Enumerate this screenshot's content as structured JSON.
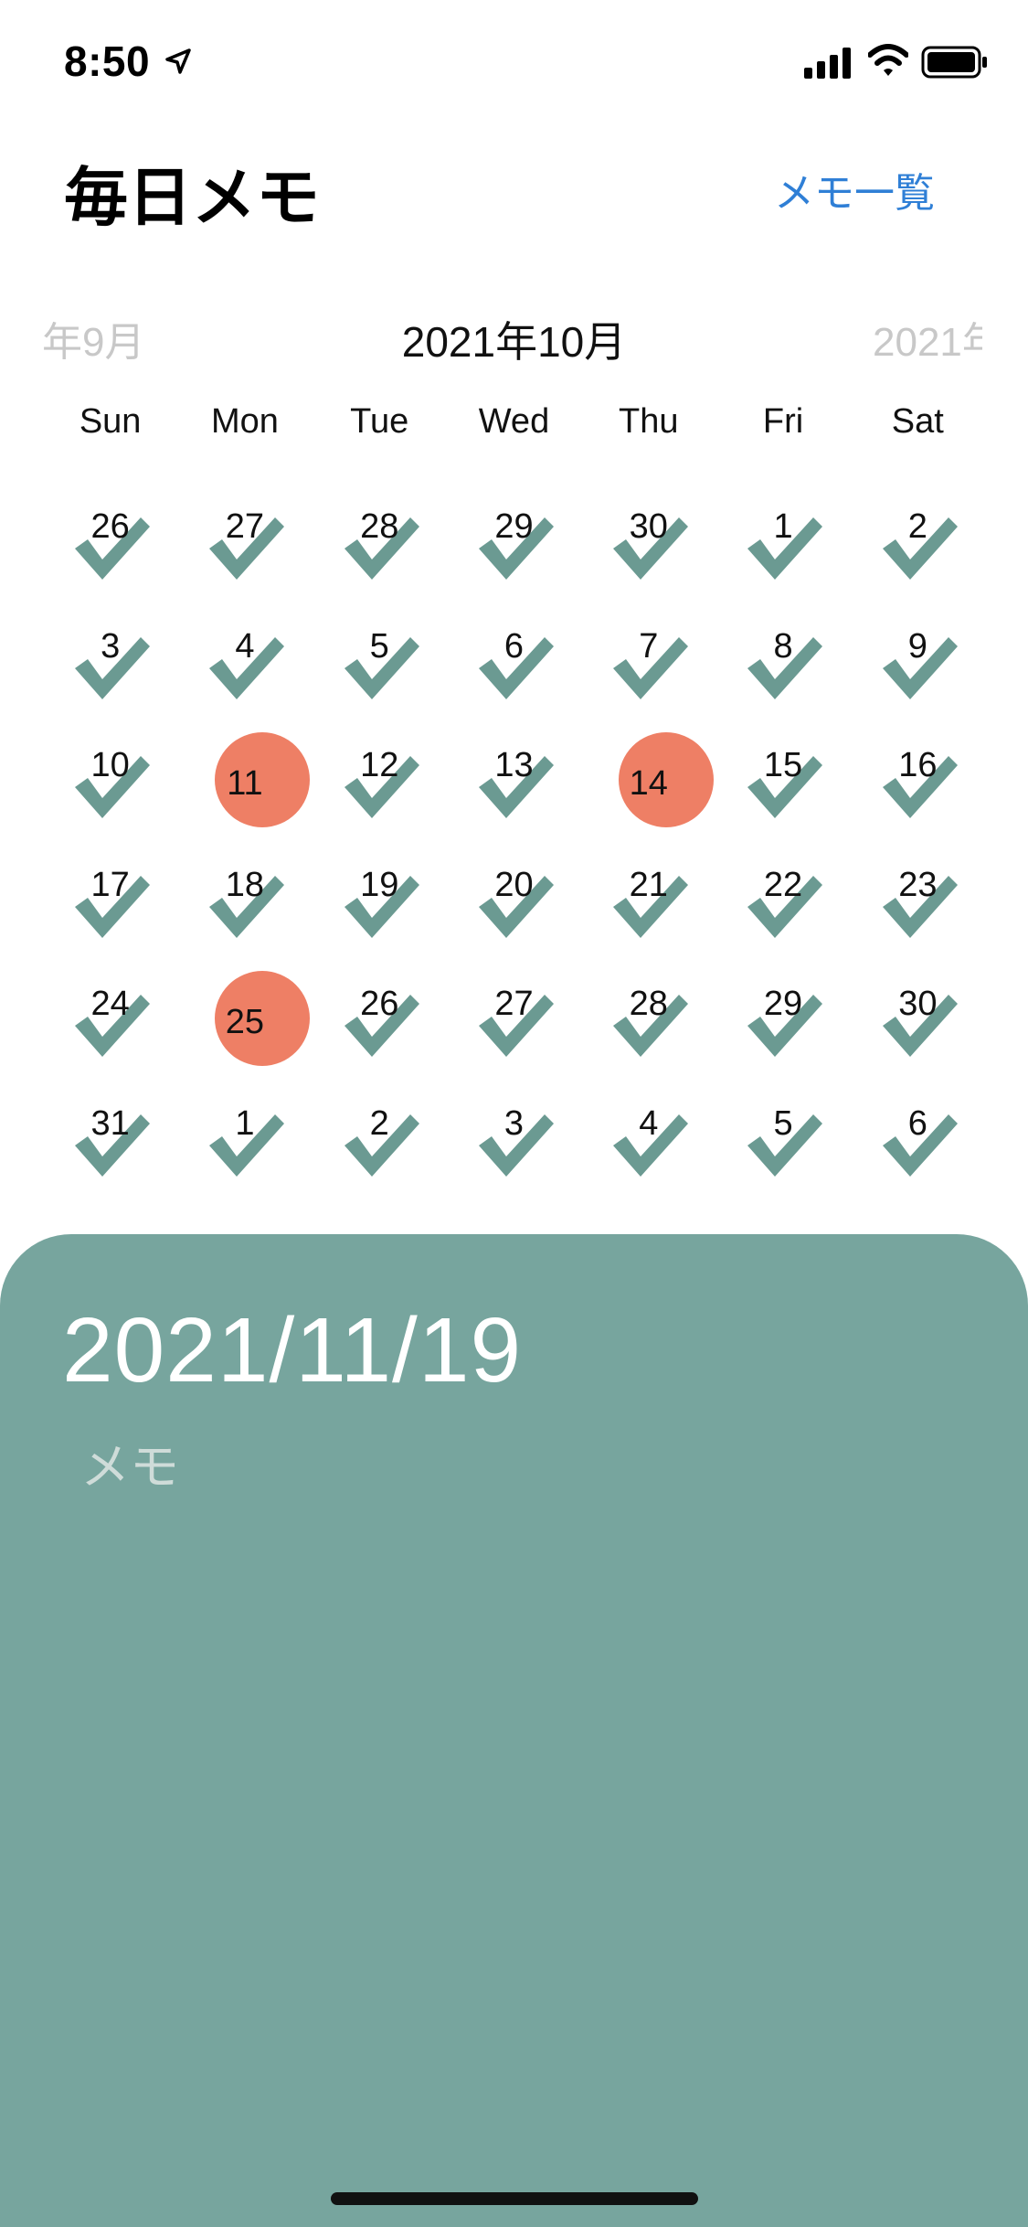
{
  "status_bar": {
    "time": "8:50",
    "icons": [
      "location-arrow-icon",
      "cellular-signal-icon",
      "wifi-icon",
      "battery-icon"
    ]
  },
  "header": {
    "title": "毎日メモ",
    "memo_list_label": "メモ一覧",
    "accent_color": "#2f7fd6"
  },
  "calendar": {
    "prev_month": "年9月",
    "current_month": "2021年10月",
    "next_month": "2021年",
    "weekdays": [
      "Sun",
      "Mon",
      "Tue",
      "Wed",
      "Thu",
      "Fri",
      "Sat"
    ],
    "weeks": [
      [
        {
          "day": "26",
          "marked": false
        },
        {
          "day": "27",
          "marked": false
        },
        {
          "day": "28",
          "marked": false
        },
        {
          "day": "29",
          "marked": false
        },
        {
          "day": "30",
          "marked": false
        },
        {
          "day": "1",
          "marked": false
        },
        {
          "day": "2",
          "marked": false
        }
      ],
      [
        {
          "day": "3",
          "marked": false
        },
        {
          "day": "4",
          "marked": false
        },
        {
          "day": "5",
          "marked": false
        },
        {
          "day": "6",
          "marked": false
        },
        {
          "day": "7",
          "marked": false
        },
        {
          "day": "8",
          "marked": false
        },
        {
          "day": "9",
          "marked": false
        }
      ],
      [
        {
          "day": "10",
          "marked": false
        },
        {
          "day": "11",
          "marked": true
        },
        {
          "day": "12",
          "marked": false
        },
        {
          "day": "13",
          "marked": false
        },
        {
          "day": "14",
          "marked": true
        },
        {
          "day": "15",
          "marked": false
        },
        {
          "day": "16",
          "marked": false
        }
      ],
      [
        {
          "day": "17",
          "marked": false
        },
        {
          "day": "18",
          "marked": false
        },
        {
          "day": "19",
          "marked": false
        },
        {
          "day": "20",
          "marked": false
        },
        {
          "day": "21",
          "marked": false
        },
        {
          "day": "22",
          "marked": false
        },
        {
          "day": "23",
          "marked": false
        }
      ],
      [
        {
          "day": "24",
          "marked": false
        },
        {
          "day": "25",
          "marked": true
        },
        {
          "day": "26",
          "marked": false
        },
        {
          "day": "27",
          "marked": false
        },
        {
          "day": "28",
          "marked": false
        },
        {
          "day": "29",
          "marked": false
        },
        {
          "day": "30",
          "marked": false
        }
      ],
      [
        {
          "day": "31",
          "marked": false
        },
        {
          "day": "1",
          "marked": false
        },
        {
          "day": "2",
          "marked": false
        },
        {
          "day": "3",
          "marked": false
        },
        {
          "day": "4",
          "marked": false
        },
        {
          "day": "5",
          "marked": false
        },
        {
          "day": "6",
          "marked": false
        }
      ]
    ],
    "check_color": "#6b9a92",
    "marked_color": "#ee7f65"
  },
  "memo_sheet": {
    "date": "2021/11/19",
    "placeholder": "メモ",
    "background_color": "#77a59e"
  }
}
